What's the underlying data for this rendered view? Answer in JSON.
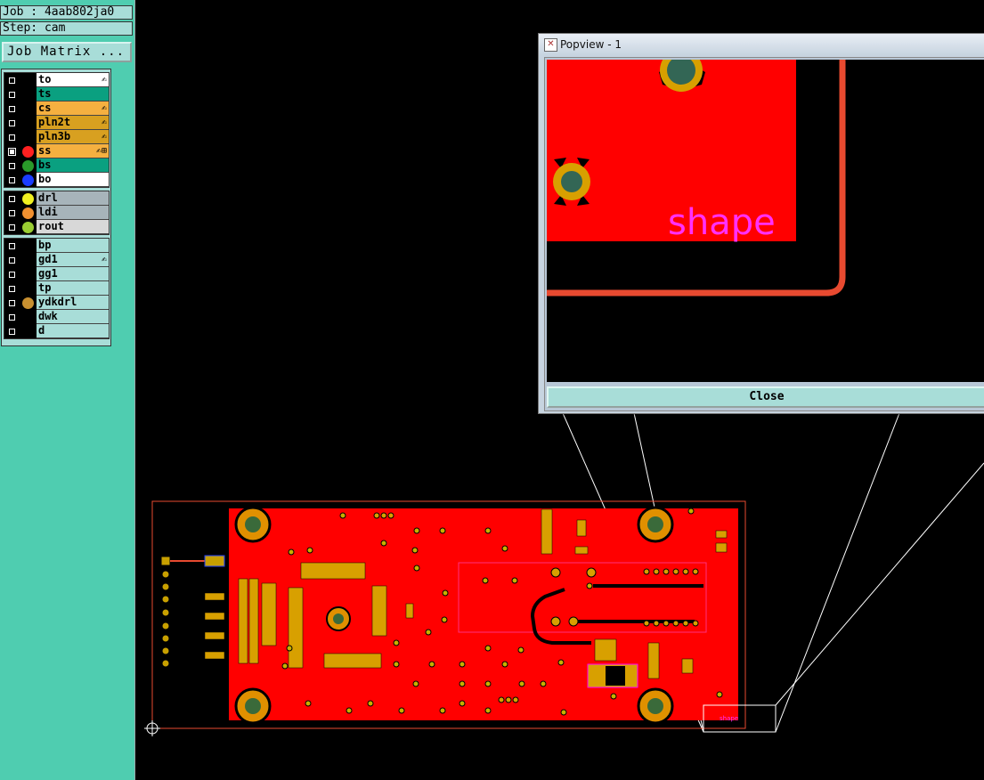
{
  "job_label": "Job : 4aab802ja0",
  "step_label": "Step: cam",
  "job_matrix_button": "Job Matrix ...",
  "layer_groups": [
    {
      "layers": [
        {
          "name": "to",
          "bg": "#ffffff",
          "dot": null,
          "edit": "✍",
          "selected": false
        },
        {
          "name": "ts",
          "bg": "#0aa080",
          "dot": null,
          "edit": "",
          "selected": false
        },
        {
          "name": "cs",
          "bg": "#f5b040",
          "dot": null,
          "edit": "✍",
          "selected": false
        },
        {
          "name": "pln2t",
          "bg": "#d8a020",
          "dot": null,
          "edit": "✍",
          "selected": false
        },
        {
          "name": "pln3b",
          "bg": "#d8a020",
          "dot": null,
          "edit": "✍",
          "selected": false
        },
        {
          "name": "ss",
          "bg": "#f5b040",
          "dot": "#ff2020",
          "edit": "✍⊞",
          "selected": true
        },
        {
          "name": "bs",
          "bg": "#0aa080",
          "dot": "#2a9a2a",
          "edit": "",
          "selected": false
        },
        {
          "name": "bo",
          "bg": "#ffffff",
          "dot": "#1a3cff",
          "edit": "",
          "selected": false
        }
      ]
    },
    {
      "layers": [
        {
          "name": "drl",
          "bg": "#a7b4ba",
          "dot": "#f0f020",
          "edit": "",
          "selected": false
        },
        {
          "name": "ldi",
          "bg": "#a7b4ba",
          "dot": "#f09030",
          "edit": "",
          "selected": false
        },
        {
          "name": "rout",
          "bg": "#d8d8d8",
          "dot": "#9acd32",
          "edit": "",
          "selected": false
        }
      ]
    },
    {
      "layers": [
        {
          "name": "bp",
          "bg": "#a8ddd8",
          "dot": null,
          "edit": "",
          "selected": false
        },
        {
          "name": "gd1",
          "bg": "#a8ddd8",
          "dot": null,
          "edit": "✍",
          "selected": false
        },
        {
          "name": "gg1",
          "bg": "#a8ddd8",
          "dot": null,
          "edit": "",
          "selected": false
        },
        {
          "name": "tp",
          "bg": "#a8ddd8",
          "dot": null,
          "edit": "",
          "selected": false
        },
        {
          "name": "ydkdrl",
          "bg": "#a8ddd8",
          "dot": "#c89030",
          "edit": "",
          "selected": false
        },
        {
          "name": "dwk",
          "bg": "#a8ddd8",
          "dot": null,
          "edit": "",
          "selected": false
        },
        {
          "name": "d",
          "bg": "#a8ddd8",
          "dot": null,
          "edit": "",
          "selected": false
        }
      ]
    }
  ],
  "popview": {
    "title": "Popview - 1",
    "zoom_text": "shape",
    "close_label": "Close"
  },
  "board": {
    "corner_label": "shape"
  }
}
